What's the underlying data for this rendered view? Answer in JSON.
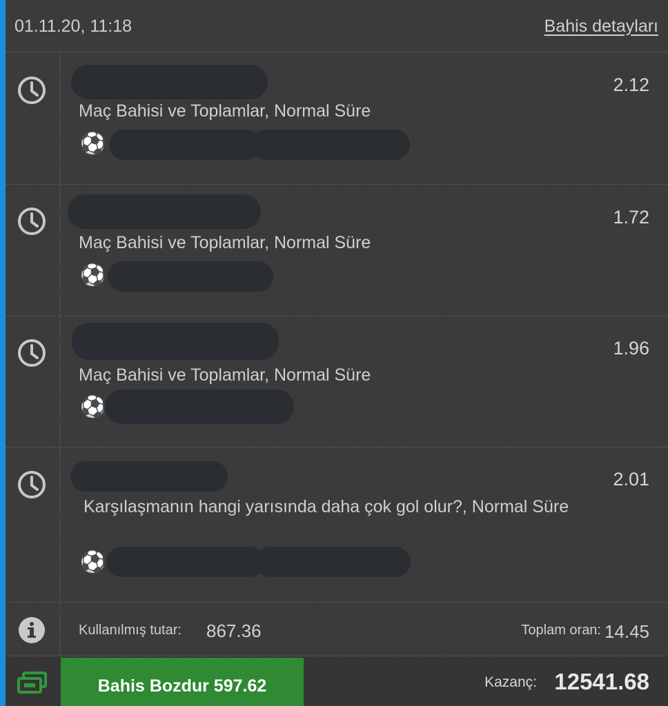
{
  "header": {
    "datetime": "01.11.20, 11:18",
    "details_link": "Bahis detayları"
  },
  "bets": [
    {
      "odds": "2.12",
      "market": "Maç Bahisi ve Toplamlar, Normal Süre",
      "sport_icon": "soccer-ball-icon",
      "status_icon": "clock-icon"
    },
    {
      "odds": "1.72",
      "market": "Maç Bahisi ve Toplamlar, Normal Süre",
      "sport_icon": "soccer-ball-icon",
      "status_icon": "clock-icon"
    },
    {
      "odds": "1.96",
      "market": "Maç Bahisi ve Toplamlar, Normal Süre",
      "sport_icon": "soccer-ball-icon",
      "status_icon": "clock-icon"
    },
    {
      "odds": "2.01",
      "market": " Karşılaşmanın hangi yarısında daha çok gol olur?, Normal Süre",
      "sport_icon": "soccer-ball-icon",
      "status_icon": "clock-icon"
    }
  ],
  "summary": {
    "stake_label": "Kullanılmış tutar:",
    "stake_value": "867.36",
    "total_odds_label": "Toplam oran:",
    "total_odds_value": "14.45"
  },
  "footer": {
    "cashout_label": "Bahis Bozdur 597.62",
    "win_label": "Kazanç:",
    "win_value": "12541.68"
  },
  "colors": {
    "background": "#3b3b3b",
    "accent": "#1a8fe0",
    "cashout_button": "#2f8a33",
    "redaction": "#2a2d31"
  }
}
